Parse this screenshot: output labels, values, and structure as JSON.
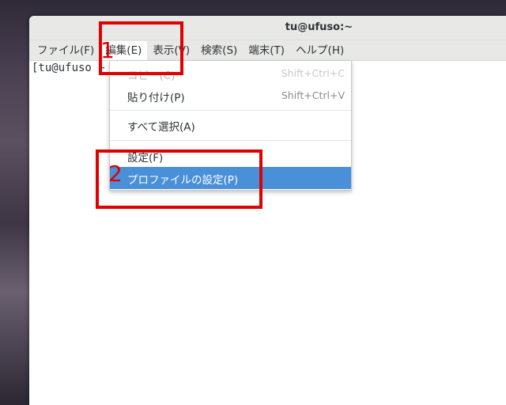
{
  "window": {
    "title": "tu@ufuso:~"
  },
  "menubar": {
    "items": [
      {
        "label": "ファイル(F)"
      },
      {
        "label": "編集(E)"
      },
      {
        "label": "表示(V)"
      },
      {
        "label": "検索(S)"
      },
      {
        "label": "端末(T)"
      },
      {
        "label": "ヘルプ(H)"
      }
    ]
  },
  "terminal": {
    "prompt": "[tu@ufuso ~"
  },
  "edit_menu": {
    "items": [
      {
        "label": "コピー(C)",
        "accel": "Shift+Ctrl+C"
      },
      {
        "label": "貼り付け(P)",
        "accel": "Shift+Ctrl+V"
      },
      {
        "label": "すべて選択(A)"
      },
      {
        "label": "設定(F)"
      },
      {
        "label": "プロファイルの設定(P)"
      }
    ]
  },
  "annotations": {
    "step1": "1",
    "step2": "2"
  },
  "colors": {
    "highlight": "#4a90d9",
    "annotation": "#e00000"
  }
}
